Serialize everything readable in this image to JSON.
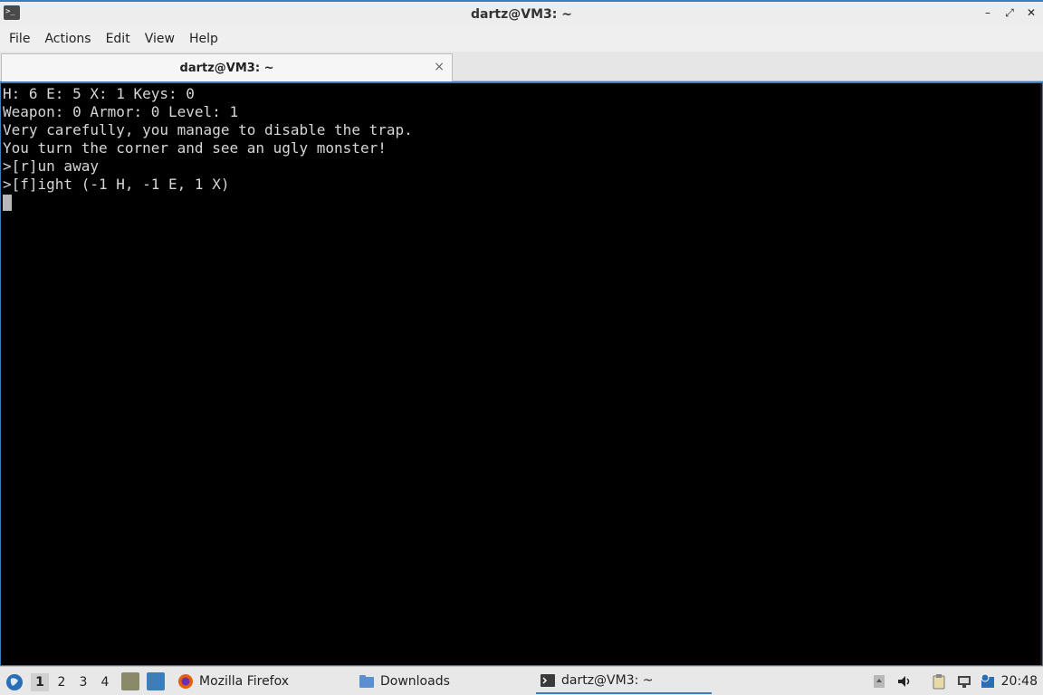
{
  "window": {
    "title": "dartz@VM3: ~",
    "controls": [
      "minimize",
      "maximize",
      "close"
    ]
  },
  "menu": [
    "File",
    "Actions",
    "Edit",
    "View",
    "Help"
  ],
  "tab": {
    "label": "dartz@VM3: ~",
    "close": "×"
  },
  "terminal": {
    "lines": [
      "H: 6 E: 5 X: 1 Keys: 0",
      "Weapon: 0 Armor: 0 Level: 1",
      "Very carefully, you manage to disable the trap.",
      "You turn the corner and see an ugly monster!",
      ">[r]un away",
      ">[f]ight (-1 H, -1 E, 1 X)"
    ]
  },
  "taskbar": {
    "workspaces": [
      "1",
      "2",
      "3",
      "4"
    ],
    "active_workspace": "1",
    "tasks": [
      {
        "label": "Mozilla Firefox",
        "icon": "firefox-icon"
      },
      {
        "label": "Downloads",
        "icon": "folder-icon"
      },
      {
        "label": "dartz@VM3: ~",
        "icon": "terminal-icon"
      }
    ],
    "clock": "20:48"
  },
  "colors": {
    "accent": "#3d7eb8",
    "terminal_bg": "#000000",
    "terminal_fg": "#d6d6d6"
  }
}
